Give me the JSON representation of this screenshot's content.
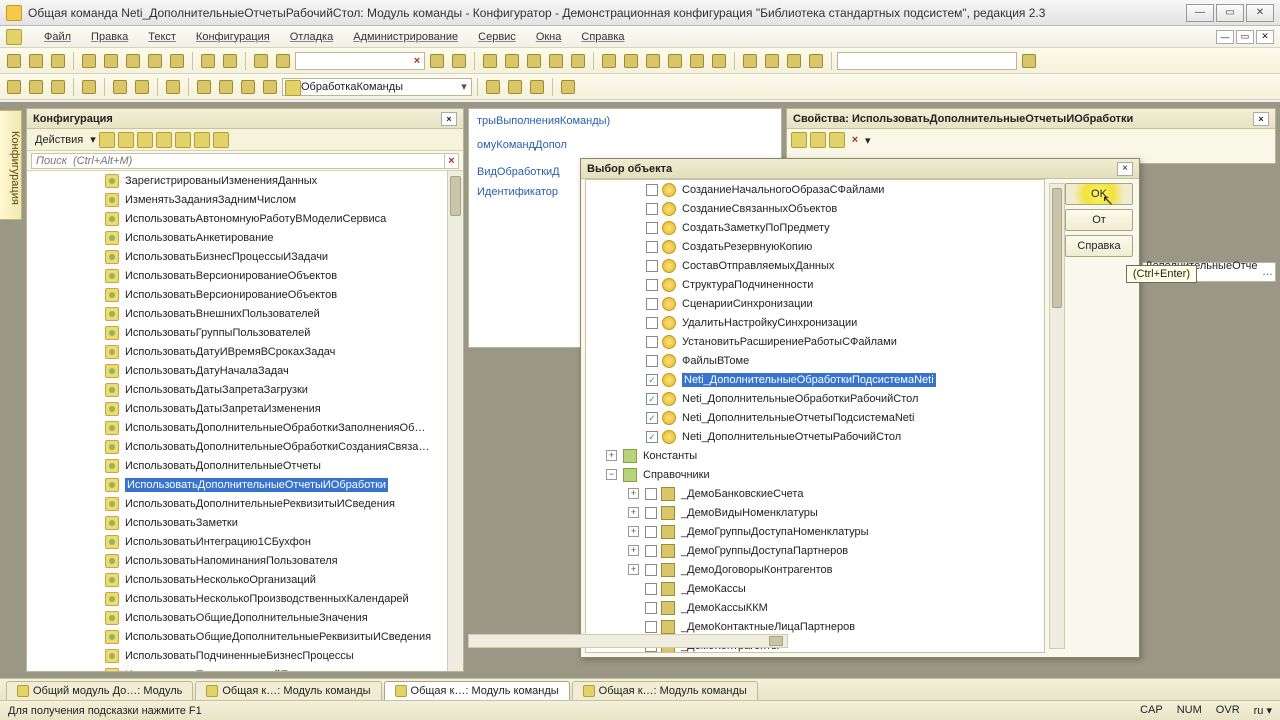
{
  "title": "Общая команда Neti_ДополнительныеОтчетыРабочийСтол: Модуль команды - Конфигуратор - Демонстрационная конфигурация \"Библиотека стандартных подсистем\", редакция 2.3",
  "menu": [
    "Файл",
    "Правка",
    "Текст",
    "Конфигурация",
    "Отладка",
    "Администрирование",
    "Сервис",
    "Окна",
    "Справка"
  ],
  "toolbar2_combo": "ОбработкаКоманды",
  "cfg": {
    "title": "Конфигурация",
    "actions": "Действия",
    "search_ph": "Поиск  (Ctrl+Alt+M)",
    "items": [
      "ЗарегистрированыИзмененияДанных",
      "ИзменятьЗаданияЗаднимЧислом",
      "ИспользоватьАвтономнуюРаботуВМоделиСервиса",
      "ИспользоватьАнкетирование",
      "ИспользоватьБизнесПроцессыИЗадачи",
      "ИспользоватьВерсионированиеОбъектов",
      "ИспользоватьВерсионированиеОбъектов",
      "ИспользоватьВнешнихПользователей",
      "ИспользоватьГруппыПользователей",
      "ИспользоватьДатуИВремяВСрокахЗадач",
      "ИспользоватьДатуНачалаЗадач",
      "ИспользоватьДатыЗапретаЗагрузки",
      "ИспользоватьДатыЗапретаИзменения",
      "ИспользоватьДополнительныеОбработкиЗаполненияОб…",
      "ИспользоватьДополнительныеОбработкиСозданияСвяза…",
      "ИспользоватьДополнительныеОтчеты",
      "ИспользоватьДополнительныеОтчетыИОбработки",
      "ИспользоватьДополнительныеРеквизитыИСведения",
      "ИспользоватьЗаметки",
      "ИспользоватьИнтеграцию1СБухфон",
      "ИспользоватьНапоминанияПользователя",
      "ИспользоватьНесколькоОрганизаций",
      "ИспользоватьНесколькоПроизводственныхКалендарей",
      "ИспользоватьОбщиеДополнительныеЗначения",
      "ИспользоватьОбщиеДополнительныеРеквизитыИСведения",
      "ИспользоватьПодчиненныеБизнесПроцессы",
      "ИспользоватьПолнотекстовыйПоиск"
    ],
    "selected_index": 16
  },
  "mid": {
    "line1": "трыВыполненияКоманды)",
    "line2": "омуКомандДопол",
    "line3": "ВидОбработкиД",
    "line4": "Идентификатор"
  },
  "props": {
    "title": "Свойства: ИспользоватьДополнительныеОтчетыИОбработки"
  },
  "extrafield": "ДополнительныеОтче …",
  "dialog": {
    "title": "Выбор объекта",
    "items": [
      {
        "c": false,
        "t": "СозданиеНачальногоОбразаСФайлами"
      },
      {
        "c": false,
        "t": "СозданиеСвязанныхОбъектов"
      },
      {
        "c": false,
        "t": "СоздатьЗаметкуПоПредмету"
      },
      {
        "c": false,
        "t": "СоздатьРезервнуюКопию"
      },
      {
        "c": false,
        "t": "СоставОтправляемыхДанных"
      },
      {
        "c": false,
        "t": "СтруктураПодчиненности"
      },
      {
        "c": false,
        "t": "СценарииСинхронизации"
      },
      {
        "c": false,
        "t": "УдалитьНастройкуСинхронизации"
      },
      {
        "c": false,
        "t": "УстановитьРасширениеРаботыСФайлами"
      },
      {
        "c": false,
        "t": "ФайлыВТоме"
      },
      {
        "c": true,
        "t": "Neti_ДополнительныеОбработкиПодсистемаNeti",
        "sel": true
      },
      {
        "c": true,
        "t": "Neti_ДополнительныеОбработкиРабочийСтол"
      },
      {
        "c": true,
        "t": "Neti_ДополнительныеОтчетыПодсистемаNeti"
      },
      {
        "c": true,
        "t": "Neti_ДополнительныеОтчетыРабочийСтол"
      }
    ],
    "group1": "Константы",
    "group2": "Справочники",
    "catalogs": [
      "_ДемоБанковскиеСчета",
      "_ДемоВидыНоменклатуры",
      "_ДемоГруппыДоступаНоменклатуры",
      "_ДемоГруппыДоступаПартнеров",
      "_ДемоДоговорыКонтрагентов",
      "_ДемоКассы",
      "_ДемоКассыККМ",
      "_ДемоКонтактныеЛицаПартнеров",
      "_ДемоКонтрагенты"
    ],
    "btn_ok": "OK",
    "btn_cancel": "От",
    "btn_help": "Справка",
    "tooltip": "(Ctrl+Enter)"
  },
  "tabs": [
    "Общий модуль До…: Модуль",
    "Общая к…: Модуль команды",
    "Общая к…: Модуль команды",
    "Общая к…: Модуль команды"
  ],
  "active_tab": 2,
  "status": {
    "hint": "Для получения подсказки нажмите F1",
    "cap": "CAP",
    "num": "NUM",
    "ovr": "OVR",
    "lang": "ru ▾"
  }
}
